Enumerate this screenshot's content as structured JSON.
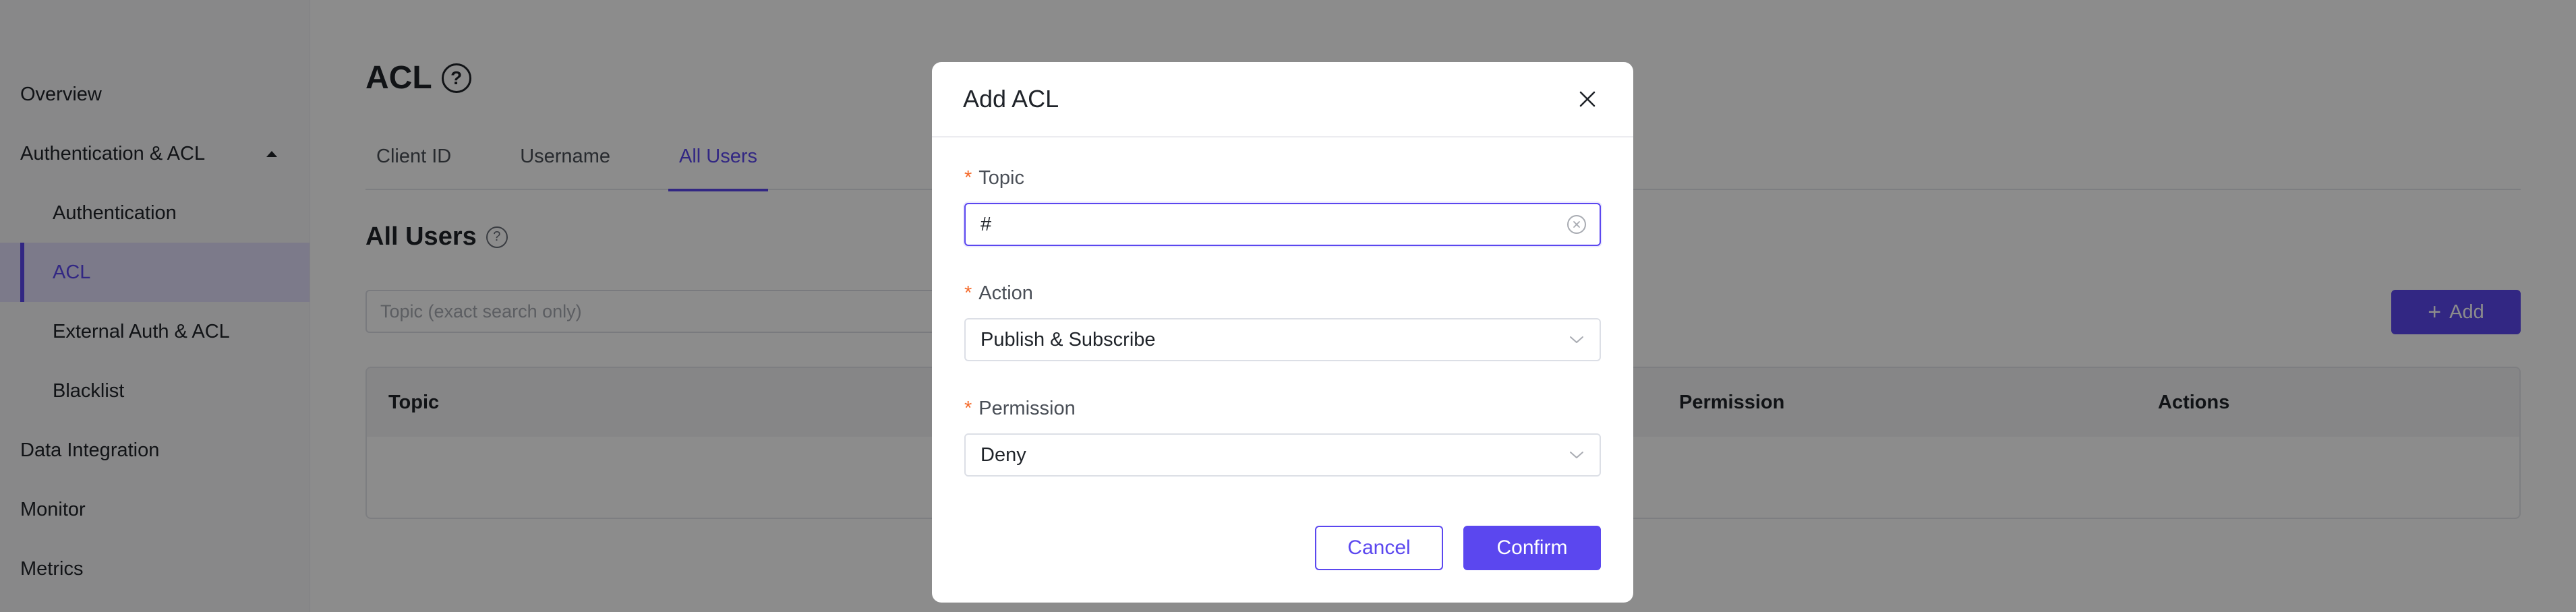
{
  "sidebar": {
    "items": [
      {
        "label": "Overview"
      },
      {
        "label": "Authentication & ACL"
      },
      {
        "label": "Authentication"
      },
      {
        "label": "ACL"
      },
      {
        "label": "External Auth & ACL"
      },
      {
        "label": "Blacklist"
      },
      {
        "label": "Data Integration"
      },
      {
        "label": "Monitor"
      },
      {
        "label": "Metrics"
      }
    ]
  },
  "page": {
    "title": "ACL",
    "tabs": [
      {
        "label": "Client ID"
      },
      {
        "label": "Username"
      },
      {
        "label": "All Users"
      }
    ],
    "section_title": "All Users",
    "search_placeholder": "Topic (exact search only)",
    "add_label": "Add",
    "table": {
      "columns": [
        "Topic",
        "Permission",
        "Actions"
      ]
    }
  },
  "modal": {
    "title": "Add ACL",
    "topic": {
      "label": "Topic",
      "value": "#"
    },
    "action": {
      "label": "Action",
      "value": "Publish & Subscribe"
    },
    "permission": {
      "label": "Permission",
      "value": "Deny"
    },
    "cancel_label": "Cancel",
    "confirm_label": "Confirm"
  },
  "colors": {
    "accent": "#5b47ef",
    "required": "#f56c2d"
  }
}
